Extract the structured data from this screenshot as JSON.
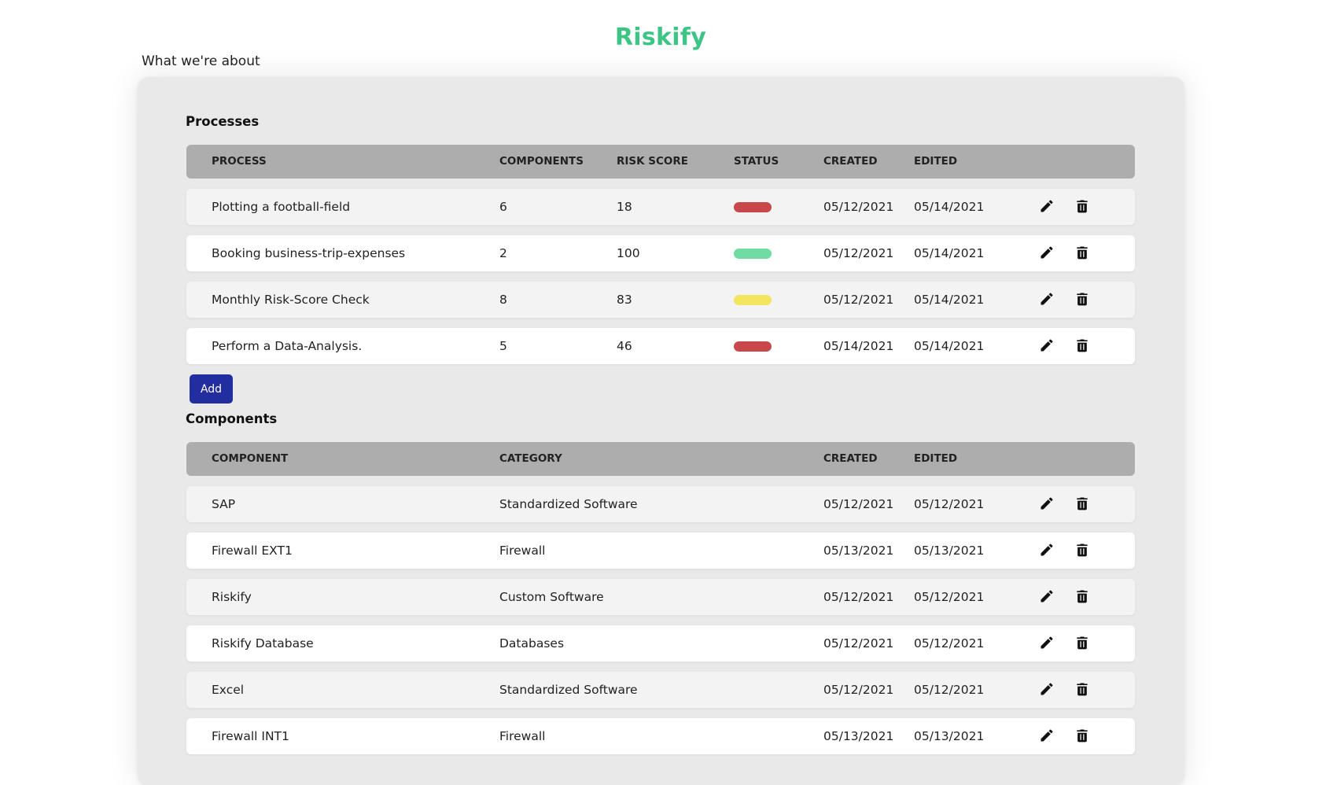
{
  "app": {
    "title": "Riskify",
    "nav_about": "What we're about"
  },
  "processes": {
    "section_title": "Processes",
    "columns": [
      "PROCESS",
      "COMPONENTS",
      "RISK SCORE",
      "STATUS",
      "CREATED",
      "EDITED"
    ],
    "rows": [
      {
        "name": "Plotting a football-field",
        "components": "6",
        "risk_score": "18",
        "status": "red",
        "created": "05/12/2021",
        "edited": "05/14/2021"
      },
      {
        "name": "Booking business-trip-expenses",
        "components": "2",
        "risk_score": "100",
        "status": "green",
        "created": "05/12/2021",
        "edited": "05/14/2021"
      },
      {
        "name": "Monthly Risk-Score Check",
        "components": "8",
        "risk_score": "83",
        "status": "yellow",
        "created": "05/12/2021",
        "edited": "05/14/2021"
      },
      {
        "name": "Perform a Data-Analysis.",
        "components": "5",
        "risk_score": "46",
        "status": "red",
        "created": "05/14/2021",
        "edited": "05/14/2021"
      }
    ],
    "add_label": "Add"
  },
  "components": {
    "section_title": "Components",
    "columns": [
      "COMPONENT",
      "CATEGORY",
      "CREATED",
      "EDITED"
    ],
    "rows": [
      {
        "name": "SAP",
        "category": "Standardized Software",
        "created": "05/12/2021",
        "edited": "05/12/2021"
      },
      {
        "name": "Firewall EXT1",
        "category": "Firewall",
        "created": "05/13/2021",
        "edited": "05/13/2021"
      },
      {
        "name": "Riskify",
        "category": "Custom Software",
        "created": "05/12/2021",
        "edited": "05/12/2021"
      },
      {
        "name": "Riskify Database",
        "category": "Databases",
        "created": "05/12/2021",
        "edited": "05/12/2021"
      },
      {
        "name": "Excel",
        "category": "Standardized Software",
        "created": "05/12/2021",
        "edited": "05/12/2021"
      },
      {
        "name": "Firewall INT1",
        "category": "Firewall",
        "created": "05/13/2021",
        "edited": "05/13/2021"
      }
    ]
  },
  "status_colors": {
    "red": "#c9474a",
    "green": "#6edca3",
    "yellow": "#f3e55e"
  },
  "icons": {
    "edit": "pencil-icon",
    "delete": "trash-icon"
  }
}
